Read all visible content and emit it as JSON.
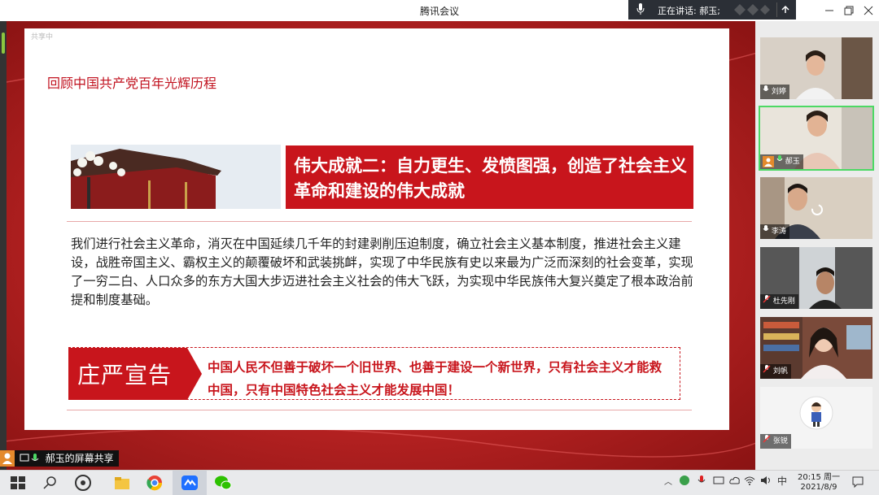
{
  "window": {
    "title": "腾讯会议",
    "speaking_label": "正在讲话: 郝玉;"
  },
  "share": {
    "watermark": "共享中",
    "label": "郝玉的屏幕共享"
  },
  "slide": {
    "title": "回顾中国共产党百年光辉历程",
    "banner": "伟大成就二：自力更生、发愤图强，创造了社会主义革命和建设的伟大成就",
    "body": "我们进行社会主义革命，消灭在中国延续几千年的封建剥削压迫制度，确立社会主义基本制度，推进社会主义建设，战胜帝国主义、霸权主义的颠覆破坏和武装挑衅，实现了中华民族有史以来最为广泛而深刻的社会变革，实现了一穷二白、人口众多的东方大国大步迈进社会主义社会的伟大飞跃，为实现中华民族伟大复兴奠定了根本政治前提和制度基础。",
    "declaration_label": "庄严宣告",
    "declaration": "中国人民不但善于破坏一个旧世界、也善于建设一个新世界，只有社会主义才能救中国，只有中国特色社会主义才能发展中国！"
  },
  "participants": [
    {
      "name": "刘婷",
      "mic": "on"
    },
    {
      "name": "郝玉",
      "mic": "on",
      "host": true
    },
    {
      "name": "李涛",
      "mic": "on"
    },
    {
      "name": "杜先刚",
      "mic": "off"
    },
    {
      "name": "刘帆",
      "mic": "off"
    },
    {
      "name": "张锐",
      "mic": "off"
    }
  ],
  "taskbar": {
    "ime": "中",
    "time": "20:15 周一",
    "date": "2021/8/9"
  },
  "colors": {
    "accent_red": "#c8151c",
    "stage_red": "#b72222",
    "taskbar": "#e9eaec"
  }
}
